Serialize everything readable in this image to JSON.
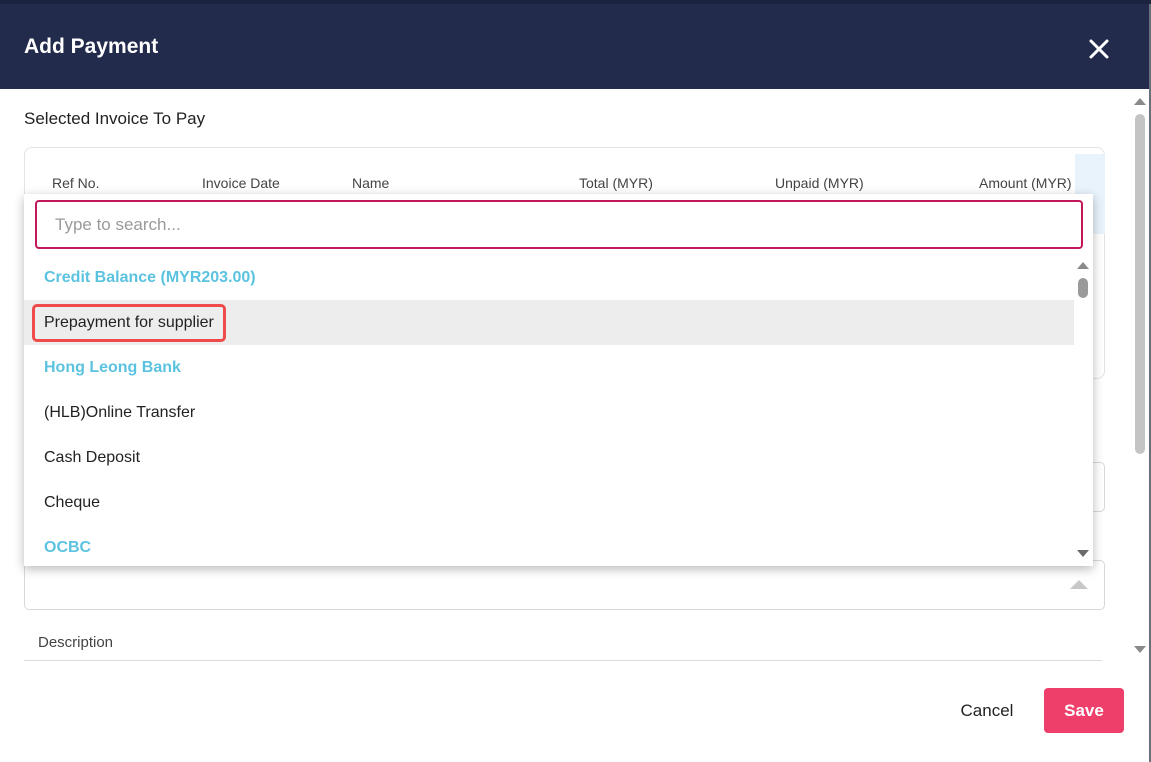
{
  "modal": {
    "title": "Add Payment",
    "section_label": "Selected Invoice To Pay",
    "table_headers": [
      "Ref No.",
      "Invoice Date",
      "Name",
      "Total (MYR)",
      "Unpaid (MYR)",
      "Amount (MYR)"
    ],
    "description_label": "Description",
    "cancel_label": "Cancel",
    "save_label": "Save",
    "icons": {
      "close": "close-icon"
    }
  },
  "dropdown": {
    "search_placeholder": "Type to search...",
    "items": [
      {
        "label": "Credit Balance (MYR203.00)",
        "type": "group"
      },
      {
        "label": "Prepayment for supplier",
        "type": "option",
        "hovered": true,
        "highlighted": true
      },
      {
        "label": "Hong Leong Bank",
        "type": "group"
      },
      {
        "label": "(HLB)Online Transfer",
        "type": "option"
      },
      {
        "label": "Cash Deposit",
        "type": "option"
      },
      {
        "label": "Cheque",
        "type": "option"
      },
      {
        "label": "OCBC",
        "type": "group"
      }
    ]
  },
  "colors": {
    "header_bg": "#232b4d",
    "accent": "#ee3f6a",
    "group_label": "#5bc3e0",
    "search_border": "#c2185b",
    "highlight_box": "#ef4b4b"
  }
}
